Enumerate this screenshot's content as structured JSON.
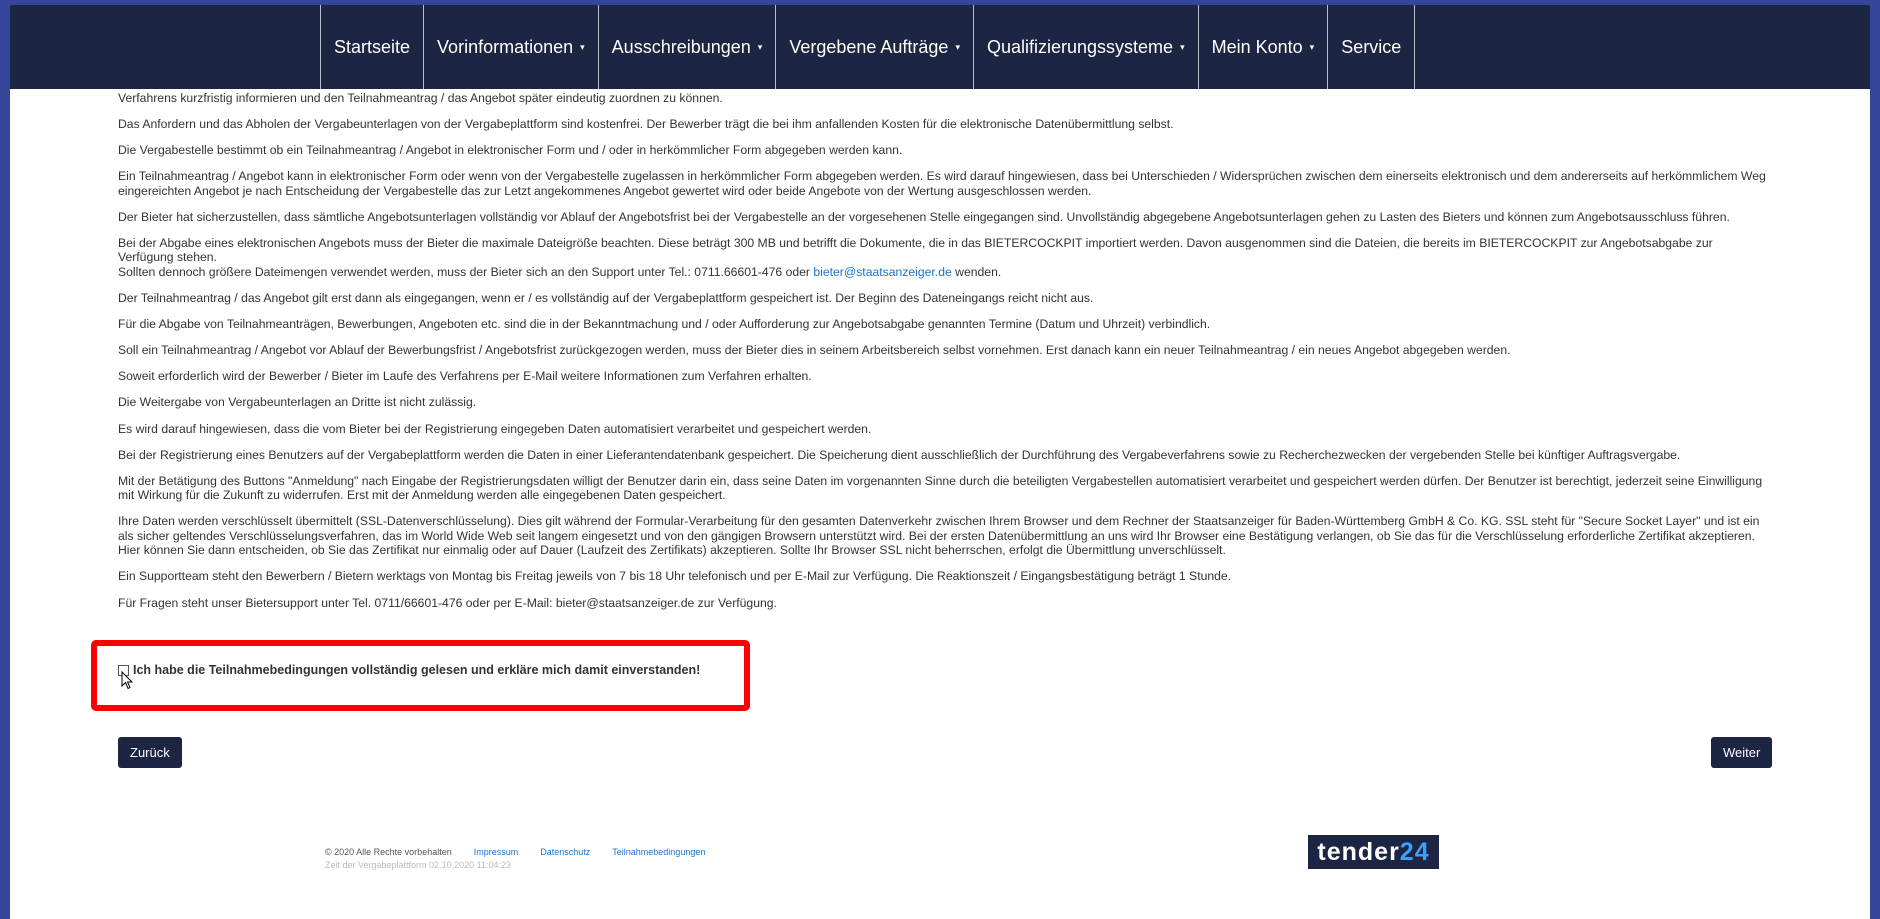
{
  "nav": {
    "items": [
      {
        "label": "Startseite",
        "dropdown": false
      },
      {
        "label": "Vorinformationen",
        "dropdown": true
      },
      {
        "label": "Ausschreibungen",
        "dropdown": true
      },
      {
        "label": "Vergebene Aufträge",
        "dropdown": true
      },
      {
        "label": "Qualifizierungssysteme",
        "dropdown": true
      },
      {
        "label": "Mein Konto",
        "dropdown": true
      },
      {
        "label": "Service",
        "dropdown": false
      }
    ],
    "caret": "▾"
  },
  "content": {
    "p1": "Verfahrens kurzfristig informieren und den Teilnahmeantrag / das Angebot später eindeutig zuordnen zu können.",
    "p2": "Das Anfordern und das Abholen der Vergabeunterlagen von der Vergabeplattform sind kostenfrei. Der Bewerber trägt die bei ihm anfallenden Kosten für die elektronische Datenübermittlung selbst.",
    "p3": "Die Vergabestelle bestimmt ob ein Teilnahmeantrag / Angebot in elektronischer Form und / oder in herkömmlicher Form abgegeben werden kann.",
    "p4": "Ein Teilnahmeantrag / Angebot kann in elektronischer Form oder wenn von der Vergabestelle zugelassen in herkömmlicher Form abgegeben werden. Es wird darauf hingewiesen, dass bei Unterschieden / Widersprüchen zwischen dem einerseits elektronisch und dem andererseits auf herkömmlichem Weg eingereichten Angebot je nach Entscheidung der Vergabestelle das zur Letzt angekommenes Angebot gewertet wird oder beide Angebote von der Wertung ausgeschlossen werden.",
    "p5": "Der Bieter hat sicherzustellen, dass sämtliche Angebotsunterlagen vollständig vor Ablauf der Angebotsfrist bei der Vergabestelle an der vorgesehenen Stelle eingegangen sind. Unvollständig abgegebene Angebotsunterlagen gehen zu Lasten des Bieters und können zum Angebotsausschluss führen.",
    "p6": "Bei der Abgabe eines elektronischen Angebots muss der Bieter die maximale Dateigröße beachten. Diese beträgt 300 MB und betrifft die Dokumente, die in das BIETERCOCKPIT importiert werden. Davon ausgenommen sind die Dateien, die bereits im BIETERCOCKPIT zur Angebotsabgabe zur Verfügung stehen.",
    "p6b_pre": "Sollten dennoch größere Dateimengen verwendet werden, muss der Bieter sich an den Support unter Tel.: 0711.66601-476 oder ",
    "p6b_email": "bieter@staatsanzeiger.de",
    "p6b_post": " wenden.",
    "p7": "Der Teilnahmeantrag / das Angebot gilt erst dann als eingegangen, wenn er / es vollständig auf der Vergabeplattform gespeichert ist. Der Beginn des Dateneingangs reicht nicht aus.",
    "p8": "Für die Abgabe von Teilnahmeanträgen, Bewerbungen, Angeboten etc. sind die in der Bekanntmachung und / oder Aufforderung zur Angebotsabgabe genannten Termine (Datum und Uhrzeit) verbindlich.",
    "p9": "Soll ein Teilnahmeantrag / Angebot vor Ablauf der Bewerbungsfrist / Angebotsfrist zurückgezogen werden, muss der Bieter dies in seinem Arbeitsbereich selbst vornehmen. Erst danach kann ein neuer Teilnahmeantrag / ein neues Angebot abgegeben werden.",
    "p10": "Soweit erforderlich wird der Bewerber / Bieter im Laufe des Verfahrens per E-Mail weitere Informationen zum Verfahren erhalten.",
    "p11": "Die Weitergabe von Vergabeunterlagen an Dritte ist nicht zulässig.",
    "p12": "Es wird darauf hingewiesen, dass die vom Bieter bei der Registrierung eingegeben Daten automatisiert verarbeitet und gespeichert werden.",
    "p13": "Bei der Registrierung eines Benutzers auf der Vergabeplattform werden die Daten in einer Lieferantendatenbank gespeichert. Die Speicherung dient ausschließlich der Durchführung des Vergabeverfahrens sowie zu Recherchezwecken der vergebenden Stelle bei künftiger Auftragsvergabe.",
    "p14": "Mit der Betätigung des Buttons \"Anmeldung\" nach Eingabe der Registrierungsdaten willigt der Benutzer darin ein, dass seine Daten im vorgenannten Sinne durch die beteiligten Vergabestellen automatisiert verarbeitet und gespeichert werden dürfen. Der Benutzer ist berechtigt, jederzeit seine Einwilligung mit Wirkung für die Zukunft zu widerrufen. Erst mit der Anmeldung werden alle eingegebenen Daten gespeichert.",
    "p15": "Ihre Daten werden verschlüsselt übermittelt (SSL-Datenverschlüsselung). Dies gilt während der Formular-Verarbeitung für den gesamten Datenverkehr zwischen Ihrem Browser und dem Rechner der Staatsanzeiger für Baden-Württemberg GmbH & Co. KG. SSL steht für \"Secure Socket Layer\" und ist ein als sicher geltendes Verschlüsselungsverfahren, das im World Wide Web seit langem eingesetzt und von den gängigen Browsern unterstützt wird. Bei der ersten Datenübermittlung an uns wird Ihr Browser eine Bestätigung verlangen, ob Sie das für die Verschlüsselung erforderliche Zertifikat akzeptieren. Hier können Sie dann entscheiden, ob Sie das Zertifikat nur einmalig oder auf Dauer (Laufzeit des Zertifikats) akzeptieren. Sollte Ihr Browser SSL nicht beherrschen, erfolgt die Übermittlung unverschlüsselt.",
    "p16": "Ein Supportteam steht den Bewerbern / Bietern werktags von Montag bis Freitag jeweils von 7 bis 18 Uhr telefonisch und per E-Mail zur Verfügung. Die Reaktionszeit / Eingangsbestätigung beträgt 1 Stunde.",
    "p17": "Für Fragen steht unser Bietersupport unter Tel. 0711/66601-476 oder per E-Mail: bieter@staatsanzeiger.de zur Verfügung."
  },
  "consent": {
    "label": "Ich habe die Teilnahmebedingungen vollständig gelesen und erkläre mich damit einverstanden!",
    "checked": false,
    "highlight_color": "#ff0000"
  },
  "buttons": {
    "back": "Zurück",
    "next": "Weiter"
  },
  "footer": {
    "copyright": "© 2020 Alle Rechte vorbehalten",
    "impressum": "Impressum",
    "datenschutz": "Datenschutz",
    "teilnahme": "Teilnahmebedingungen",
    "time": "Zeit der Vergabeplattform 02.10.2020 11:04:23"
  },
  "logo": {
    "text": "tender",
    "number": "24"
  },
  "colors": {
    "nav_bg": "#1c2541",
    "link": "#1a73c8",
    "outer_bg": "#34459a"
  }
}
